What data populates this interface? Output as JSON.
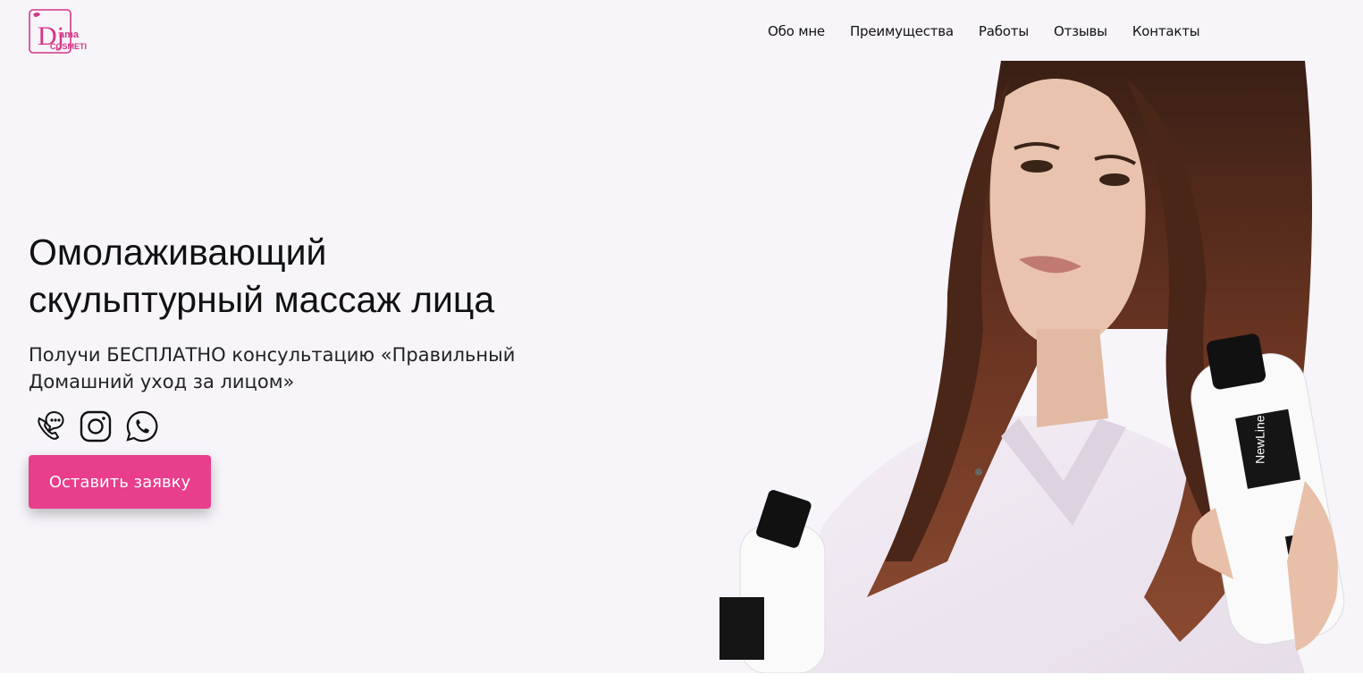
{
  "header": {
    "logo": {
      "text_top": "ama",
      "text_bottom": "COSMETI",
      "letter": "Dj"
    },
    "nav": [
      "Обо мне",
      "Преимущества",
      "Работы",
      "Отзывы",
      "Контакты"
    ]
  },
  "hero": {
    "title_line1": "Омолаживающий",
    "title_line2": "скульптурный массаж лица",
    "subtitle_line1": "Получи БЕСПЛАТНО консультацию «Правильный",
    "subtitle_line2": "Домашний уход за лицом»",
    "cta_label": "Оставить заявку",
    "socials": [
      "phone-icon",
      "instagram-icon",
      "whatsapp-icon"
    ]
  },
  "photo": {
    "bottle_brand": "NewLine"
  },
  "colors": {
    "accent": "#e83e8c",
    "background": "#f7f5fa"
  }
}
